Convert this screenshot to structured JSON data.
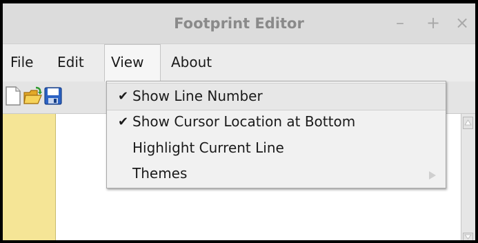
{
  "window": {
    "title": "Footprint Editor",
    "minimize_glyph": "–",
    "maximize_glyph": "+",
    "close_glyph": "×"
  },
  "menubar": {
    "items": [
      {
        "label": "File"
      },
      {
        "label": "Edit"
      },
      {
        "label": "View",
        "open": true
      },
      {
        "label": "About"
      }
    ]
  },
  "toolbar": {
    "icons": [
      "new-file-icon",
      "open-folder-icon",
      "save-icon"
    ]
  },
  "view_menu": {
    "items": [
      {
        "label": "Show Line Number",
        "checked": true,
        "highlighted": true
      },
      {
        "label": "Show Cursor Location at Bottom",
        "checked": true
      },
      {
        "label": "Highlight Current Line",
        "checked": false
      },
      {
        "label": "Themes",
        "checked": false,
        "has_submenu": true
      }
    ],
    "check_glyph": "✔"
  },
  "colors": {
    "gutter": "#f5e596",
    "editor": "#ffffff",
    "menu_bg": "#f1f1f1",
    "titlebar": "#dcdcdc"
  }
}
